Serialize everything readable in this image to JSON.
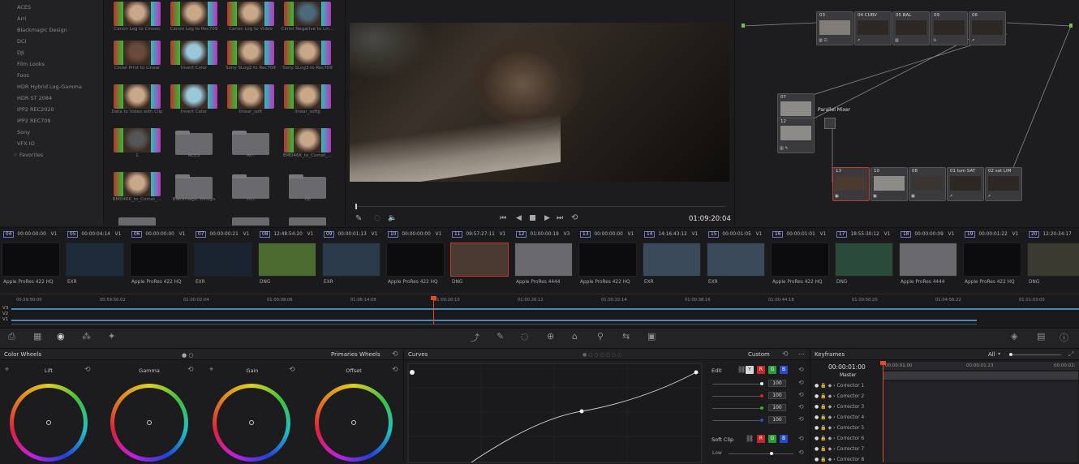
{
  "lut_sidebar": {
    "items": [
      "ACES",
      "Arri",
      "Blackmagic Design",
      "DCI",
      "DJI",
      "Film Looks",
      "Foos",
      "HDR Hybrid Log-Gamma",
      "HDR ST 2084",
      "IPP2 REC2020",
      "IPP2 REC709",
      "Sony",
      "VFX IO"
    ],
    "favorites_label": "Favorites"
  },
  "lut_browser": {
    "rows": [
      [
        "Canon Log to Cineon",
        "Canon Log to Rec709",
        "Canon Log to Video",
        "Cintel Negative to Lin..."
      ],
      [
        "Cintel Print to Linear",
        "Invert Color",
        "Sony SLog2 to Rec709",
        "Sony SLog3 to Rec709"
      ],
      [
        "Data to Video with Clip",
        "Invert Color",
        "linear_soft",
        "linear_softjj"
      ],
      [
        "1",
        "ACES",
        "Arri",
        "BMD46K_to_Comet_..."
      ],
      [
        "BMD46K_to_Comet_...",
        "Blackmagic Design",
        "DCI",
        "DJI"
      ]
    ]
  },
  "viewer": {
    "timecode": "01:09:20:04"
  },
  "nodes": {
    "top": [
      "03",
      "04 CURV",
      "05 BAL",
      "09",
      "06"
    ],
    "mid": [
      "07",
      "12"
    ],
    "parallel_label": "Parallel Mixer",
    "bottom": [
      "13",
      "10",
      "08",
      "01 lum SAT",
      "02 sat LIM"
    ]
  },
  "clips": [
    {
      "num": "04",
      "tc": "00:00:00:00",
      "track": "V1",
      "codec": "Apple ProRes 422 HQ"
    },
    {
      "num": "05",
      "tc": "00:00:04:14",
      "track": "V1",
      "codec": "EXR"
    },
    {
      "num": "06",
      "tc": "00:00:00:00",
      "track": "V1",
      "codec": "Apple ProRes 422 HQ"
    },
    {
      "num": "07",
      "tc": "00:00:00:21",
      "track": "V1",
      "codec": "EXR"
    },
    {
      "num": "08",
      "tc": "12:48:54:20",
      "track": "V1",
      "codec": "DNG"
    },
    {
      "num": "09",
      "tc": "00:00:01:13",
      "track": "V1",
      "codec": "EXR"
    },
    {
      "num": "10",
      "tc": "00:00:00:00",
      "track": "V1",
      "codec": "Apple ProRes 422 HQ"
    },
    {
      "num": "11",
      "tc": "09:57:27:11",
      "track": "V1",
      "codec": "DNG"
    },
    {
      "num": "12",
      "tc": "01:00:00:19",
      "track": "V3",
      "codec": "Apple ProRes 4444"
    },
    {
      "num": "13",
      "tc": "00:00:00:00",
      "track": "V1",
      "codec": "Apple ProRes 422 HQ"
    },
    {
      "num": "14",
      "tc": "14:16:43:12",
      "track": "V1",
      "codec": "EXR"
    },
    {
      "num": "15",
      "tc": "00:00:01:05",
      "track": "V1",
      "codec": "EXR"
    },
    {
      "num": "16",
      "tc": "00:00:01:01",
      "track": "V1",
      "codec": "Apple ProRes 422 HQ"
    },
    {
      "num": "17",
      "tc": "18:55:30:12",
      "track": "V1",
      "codec": "DNG"
    },
    {
      "num": "18",
      "tc": "00:00:00:09",
      "track": "V1",
      "codec": "Apple ProRes 4444"
    },
    {
      "num": "19",
      "tc": "00:00:01:22",
      "track": "V1",
      "codec": "Apple ProRes 422 HQ"
    },
    {
      "num": "20",
      "tc": "12:20:34:17",
      "track": "",
      "codec": "DNG"
    }
  ],
  "mini_timeline": {
    "ruler": [
      "00:59:50:00",
      "00:59:56:02",
      "01:00:02:04",
      "01:00:08:06",
      "01:06:14:08",
      "01:00:20:10",
      "01:00:26:12",
      "01:00:32:14",
      "01:00:38:16",
      "01:00:44:18",
      "01:00:50:20",
      "01:04:56:22",
      "01:01:03:00"
    ],
    "tracks": [
      "V3",
      "V2",
      "V1"
    ]
  },
  "color_wheels": {
    "title": "Color Wheels",
    "mode": "Primaries Wheels",
    "wheels": [
      "Lift",
      "Gamma",
      "Gain",
      "Offset"
    ]
  },
  "curves": {
    "title": "Curves",
    "mode": "Custom",
    "edit_label": "Edit",
    "y_label": "Y",
    "r_label": "R",
    "g_label": "G",
    "b_label": "B",
    "values": [
      "100",
      "100",
      "100",
      "100"
    ],
    "soft_clip_label": "Soft Clip",
    "low_label": "Low"
  },
  "keyframes": {
    "title": "Keyframes",
    "filter": "All",
    "timecode": "00:00:01:00",
    "ruler": [
      "00:00:01:00",
      "00:00:01:23",
      "00:00:02:"
    ],
    "rows": [
      "Master",
      "Corrector 1",
      "Corrector 2",
      "Corrector 3",
      "Corrector 4",
      "Corrector 5",
      "Corrector 6",
      "Corrector 7",
      "Corrector 8"
    ]
  }
}
